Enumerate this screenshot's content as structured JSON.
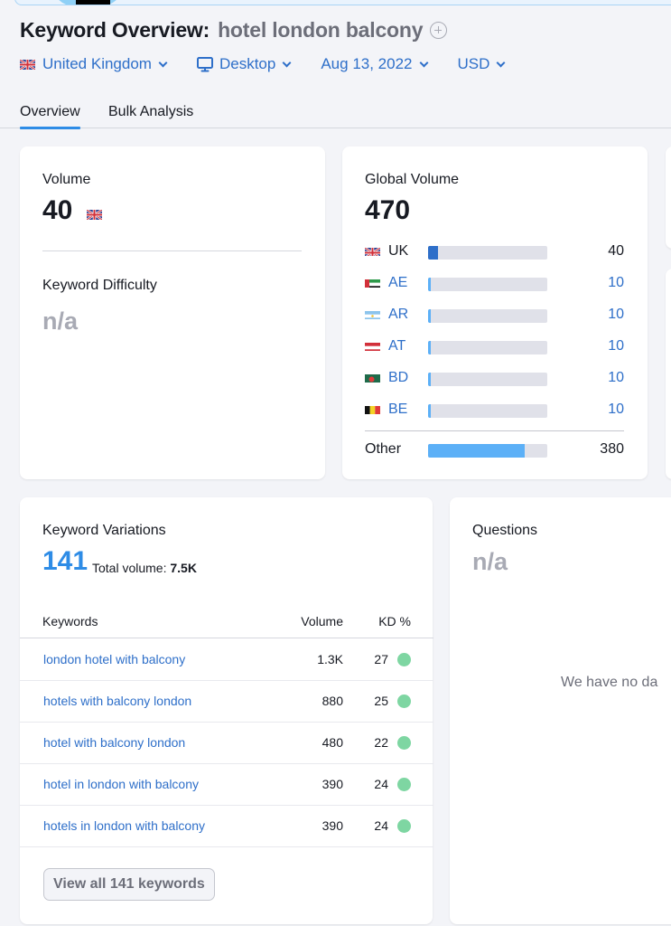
{
  "header": {
    "title_label": "Keyword Overview:",
    "keyword": "hotel london balcony"
  },
  "filters": {
    "country": "United Kingdom",
    "device": "Desktop",
    "date": "Aug 13, 2022",
    "currency": "USD"
  },
  "tabs": [
    {
      "label": "Overview",
      "active": true
    },
    {
      "label": "Bulk Analysis",
      "active": false
    }
  ],
  "volume_card": {
    "title": "Volume",
    "value": "40",
    "kd_title": "Keyword Difficulty",
    "kd_value": "n/a"
  },
  "global_volume": {
    "title": "Global Volume",
    "value": "470",
    "rows": [
      {
        "code": "UK",
        "flag": "uk-flag",
        "value": "40",
        "share": 0.085,
        "link": false
      },
      {
        "code": "AE",
        "flag": "ae-flag",
        "value": "10",
        "share": 0.021,
        "link": true
      },
      {
        "code": "AR",
        "flag": "ar-flag",
        "value": "10",
        "share": 0.021,
        "link": true
      },
      {
        "code": "AT",
        "flag": "at-flag",
        "value": "10",
        "share": 0.021,
        "link": true
      },
      {
        "code": "BD",
        "flag": "bd-flag",
        "value": "10",
        "share": 0.021,
        "link": true
      },
      {
        "code": "BE",
        "flag": "be-flag",
        "value": "10",
        "share": 0.021,
        "link": true
      }
    ],
    "other": {
      "label": "Other",
      "value": "380",
      "share": 0.81
    }
  },
  "keyword_variations": {
    "title": "Keyword Variations",
    "count": "141",
    "total_label": "Total volume:",
    "total_value": "7.5K",
    "columns": [
      "Keywords",
      "Volume",
      "KD %"
    ],
    "rows": [
      {
        "keyword": "london hotel with balcony",
        "volume": "1.3K",
        "kd": "27"
      },
      {
        "keyword": "hotels with balcony london",
        "volume": "880",
        "kd": "25"
      },
      {
        "keyword": "hotel with balcony london",
        "volume": "480",
        "kd": "22"
      },
      {
        "keyword": "hotel in london with balcony",
        "volume": "390",
        "kd": "24"
      },
      {
        "keyword": "hotels in london with balcony",
        "volume": "390",
        "kd": "24"
      }
    ],
    "view_all_label": "View all 141 keywords"
  },
  "questions": {
    "title": "Questions",
    "value": "n/a",
    "empty_message": "We have no da"
  },
  "colors": {
    "link": "#2e6fc9",
    "uk_bar": "#2e6fc9",
    "country_bar": "#5cb0f7",
    "other_bar": "#5cb0f7",
    "bar_track": "#e0e1e9",
    "kd_easy": "#7ed6a2",
    "tab_underline": "#2e8ce6"
  }
}
